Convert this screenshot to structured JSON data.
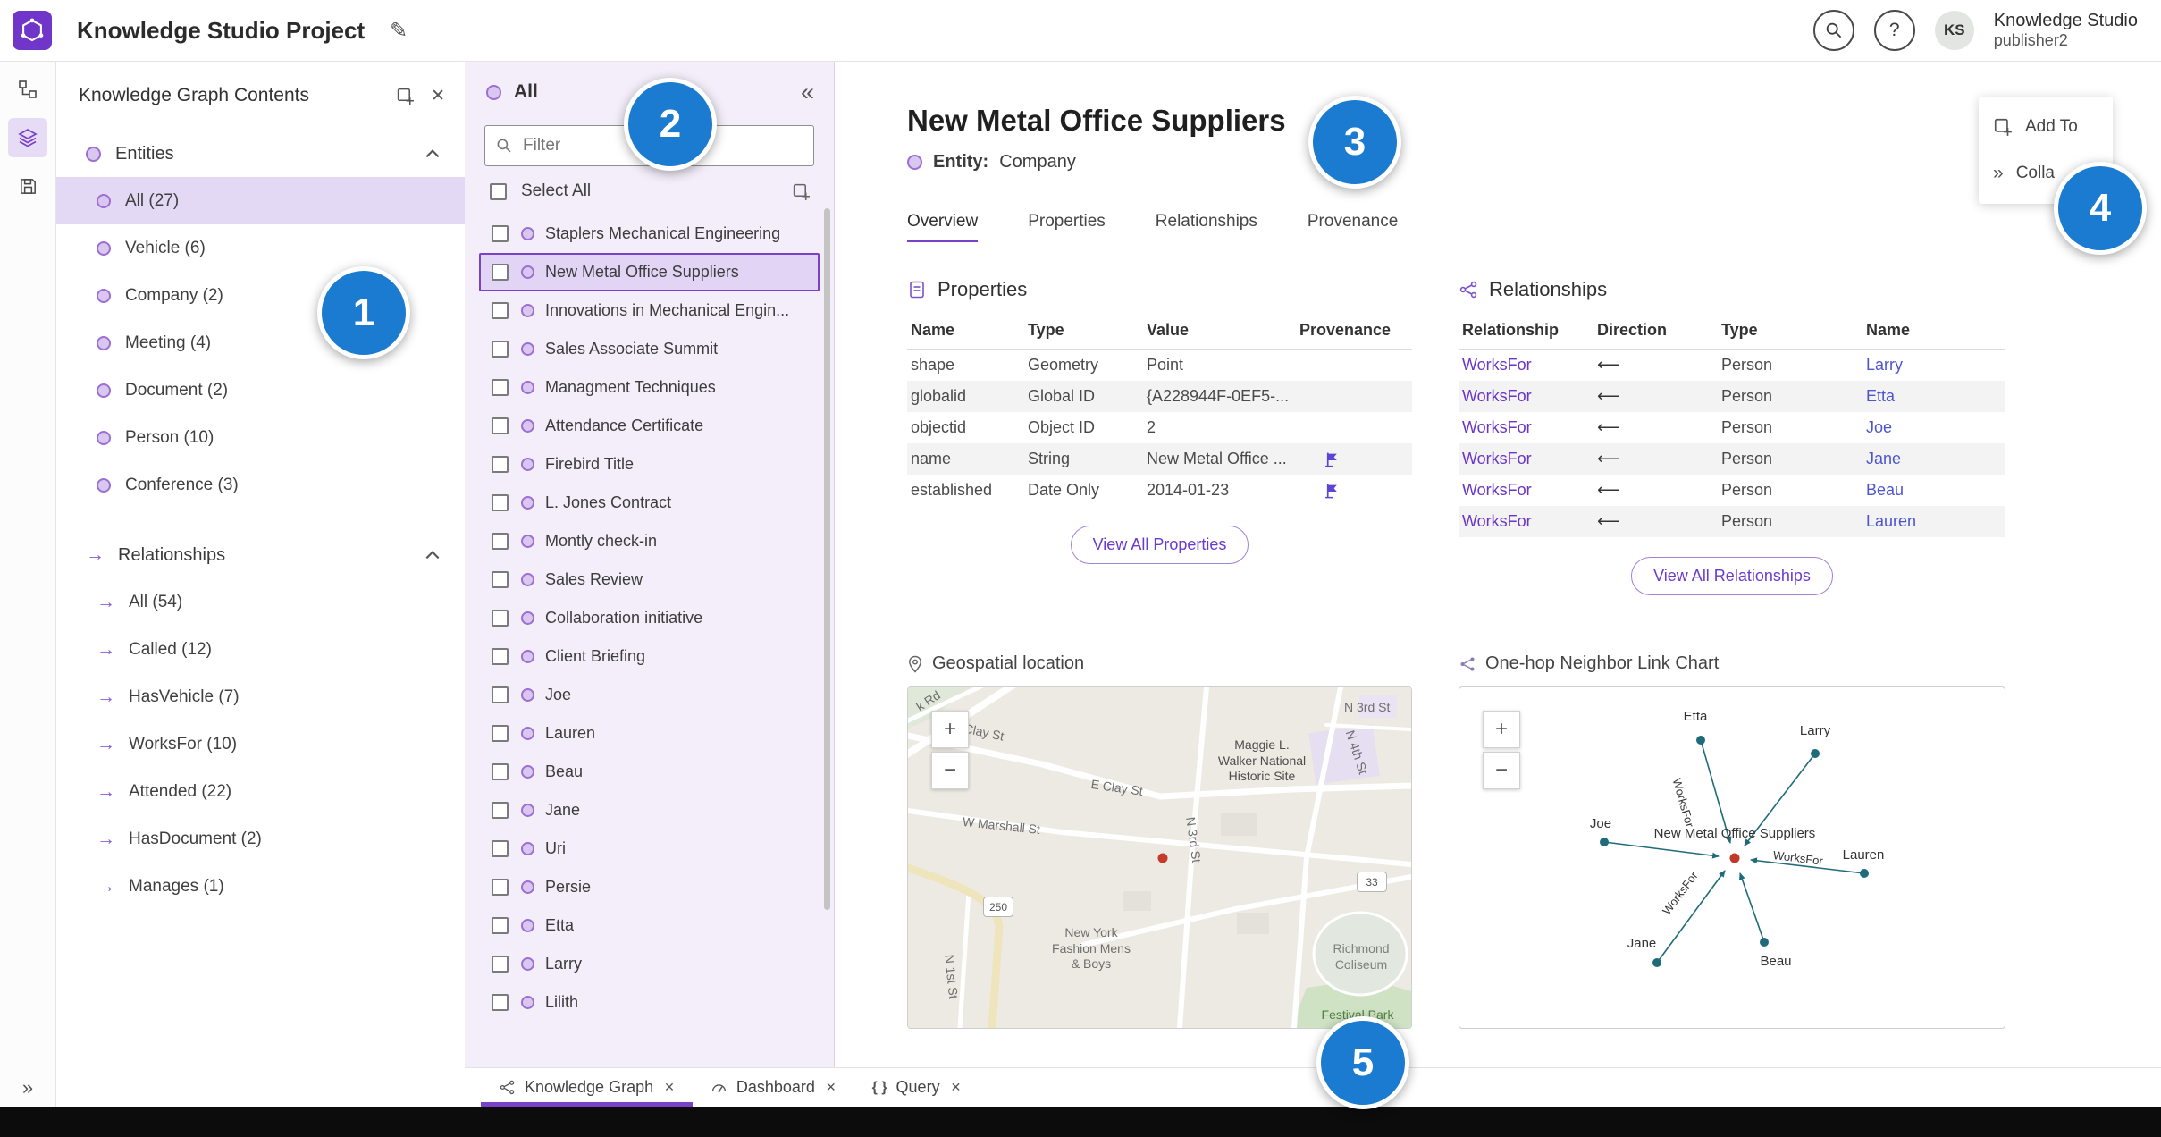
{
  "theme": {
    "accent": "#7a42c9",
    "selection_bg": "#e4d9f5",
    "annotation_blue": "#1b7bd0",
    "edge_teal": "#1e6b7a",
    "link_purple": "#6a35c9",
    "link_blue": "#4d55cf"
  },
  "ui": {
    "close": "✕",
    "collapse": "«",
    "expand": "»",
    "edit": "✎",
    "help": "?",
    "zoom_in": "+",
    "zoom_out": "−",
    "arrow_right": "→"
  },
  "header": {
    "app_title": "Knowledge Studio Project",
    "user_name": "Knowledge Studio",
    "user_role": "publisher2",
    "avatar_initials": "KS"
  },
  "contents_panel": {
    "title": "Knowledge Graph Contents",
    "entities": {
      "label": "Entities",
      "items": [
        {
          "label": "All (27)",
          "selected": true
        },
        {
          "label": "Vehicle (6)"
        },
        {
          "label": "Company (2)"
        },
        {
          "label": "Meeting (4)"
        },
        {
          "label": "Document (2)"
        },
        {
          "label": "Person (10)"
        },
        {
          "label": "Conference (3)"
        }
      ]
    },
    "relationships": {
      "label": "Relationships",
      "items": [
        {
          "label": "All (54)"
        },
        {
          "label": "Called (12)"
        },
        {
          "label": "HasVehicle (7)"
        },
        {
          "label": "WorksFor (10)"
        },
        {
          "label": "Attended (22)"
        },
        {
          "label": "HasDocument (2)"
        },
        {
          "label": "Manages (1)"
        }
      ]
    }
  },
  "list_panel": {
    "title": "All",
    "filter_placeholder": "Filter",
    "select_all_label": "Select All",
    "items": [
      {
        "label": "Staplers Mechanical Engineering"
      },
      {
        "label": "New Metal Office Suppliers",
        "selected": true
      },
      {
        "label": "Innovations in Mechanical Engin..."
      },
      {
        "label": "Sales Associate Summit"
      },
      {
        "label": "Managment Techniques"
      },
      {
        "label": "Attendance Certificate"
      },
      {
        "label": "Firebird Title"
      },
      {
        "label": "L. Jones Contract"
      },
      {
        "label": "Montly check-in"
      },
      {
        "label": "Sales Review"
      },
      {
        "label": "Collaboration initiative"
      },
      {
        "label": "Client Briefing"
      },
      {
        "label": "Joe"
      },
      {
        "label": "Lauren"
      },
      {
        "label": "Beau"
      },
      {
        "label": "Jane"
      },
      {
        "label": "Uri"
      },
      {
        "label": "Persie"
      },
      {
        "label": "Etta"
      },
      {
        "label": "Larry"
      },
      {
        "label": "Lilith"
      }
    ]
  },
  "detail": {
    "title": "New Metal Office Suppliers",
    "entity_label": "Entity:",
    "entity_type": "Company",
    "tabs": [
      {
        "label": "Overview",
        "active": true
      },
      {
        "label": "Properties"
      },
      {
        "label": "Relationships"
      },
      {
        "label": "Provenance"
      }
    ],
    "properties": {
      "heading": "Properties",
      "columns": [
        "Name",
        "Type",
        "Value",
        "Provenance"
      ],
      "rows": [
        {
          "name": "shape",
          "type": "Geometry",
          "value": "Point",
          "provenance": false
        },
        {
          "name": "globalid",
          "type": "Global ID",
          "value": "{A228944F-0EF5-...",
          "provenance": false
        },
        {
          "name": "objectid",
          "type": "Object ID",
          "value": "2",
          "provenance": false
        },
        {
          "name": "name",
          "type": "String",
          "value": "New Metal Office ...",
          "provenance": true
        },
        {
          "name": "established",
          "type": "Date Only",
          "value": "2014-01-23",
          "provenance": true
        }
      ],
      "view_all_label": "View All Properties"
    },
    "relationships": {
      "heading": "Relationships",
      "columns": [
        "Relationship",
        "Direction",
        "Type",
        "Name"
      ],
      "rows": [
        {
          "relationship": "WorksFor",
          "direction": "⟵",
          "type": "Person",
          "name": "Larry"
        },
        {
          "relationship": "WorksFor",
          "direction": "⟵",
          "type": "Person",
          "name": "Etta"
        },
        {
          "relationship": "WorksFor",
          "direction": "⟵",
          "type": "Person",
          "name": "Joe"
        },
        {
          "relationship": "WorksFor",
          "direction": "⟵",
          "type": "Person",
          "name": "Jane"
        },
        {
          "relationship": "WorksFor",
          "direction": "⟵",
          "type": "Person",
          "name": "Beau"
        },
        {
          "relationship": "WorksFor",
          "direction": "⟵",
          "type": "Person",
          "name": "Lauren"
        }
      ],
      "view_all_label": "View All Relationships"
    },
    "geospatial": {
      "heading": "Geospatial location",
      "map_labels": {
        "road_top_left": "k Rd",
        "w_clay": "W Clay St",
        "e_clay": "E Clay St",
        "n_3rd_top": "N 3rd St",
        "n_4th": "N 4th St",
        "n_3rd_mid": "N 3rd St",
        "w_marshall": "W Marshall St",
        "n_1st": "N 1st St",
        "route_250": "250",
        "route_33": "33",
        "maggie_1": "Maggie L.",
        "maggie_2": "Walker National",
        "maggie_3": "Historic Site",
        "nyf_1": "New York",
        "nyf_2": "Fashion Mens",
        "nyf_3": "& Boys",
        "coliseum_1": "Richmond",
        "coliseum_2": "Coliseum",
        "festival_park": "Festival Park"
      }
    },
    "link_chart": {
      "heading": "One-hop Neighbor Link Chart",
      "center_label": "New Metal Office Suppliers",
      "edge_label": "WorksFor",
      "nodes": [
        {
          "name": "Etta"
        },
        {
          "name": "Larry"
        },
        {
          "name": "Joe"
        },
        {
          "name": "Lauren"
        },
        {
          "name": "Jane"
        },
        {
          "name": "Beau"
        }
      ]
    }
  },
  "floating_actions": {
    "add_to": "Add To",
    "collapse_label": "Colla"
  },
  "bottom_tabs": [
    {
      "label": "Knowledge Graph",
      "active": true
    },
    {
      "label": "Dashboard"
    },
    {
      "label": "Query",
      "glyph": "{ }"
    }
  ],
  "annotations": {
    "one": "1",
    "two": "2",
    "three": "3",
    "four": "4",
    "five": "5"
  }
}
